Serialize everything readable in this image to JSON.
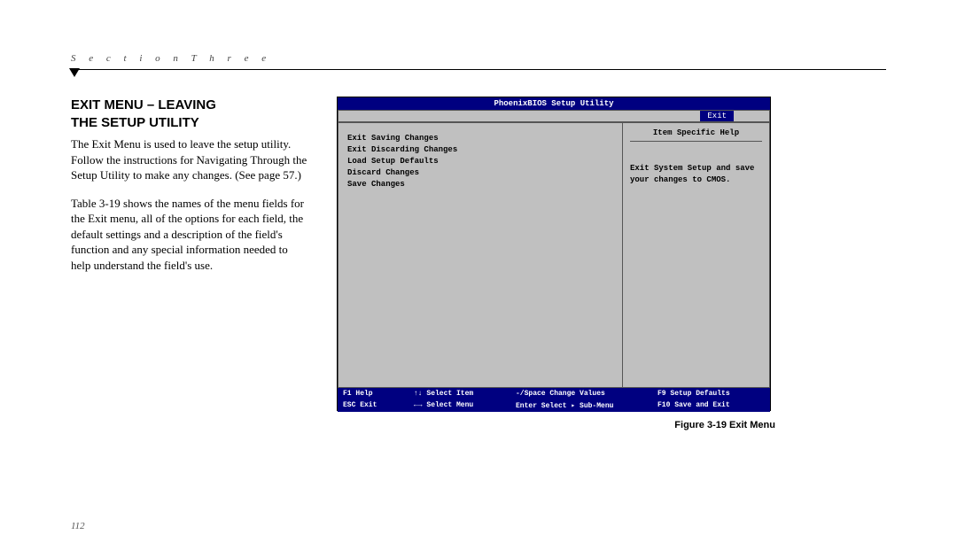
{
  "section_header": "S e c t i o n   T h r e e",
  "heading_line1": "EXIT MENU – LEAVING",
  "heading_line2": "THE SETUP UTILITY",
  "para1": "The Exit Menu is used to leave the setup utility. Follow the instructions for Navigating Through the Setup Utility to make any changes. (See page 57.)",
  "para2": "Table 3-19 shows the names of the menu fields for the Exit menu, all of the options for each field, the default settings and a description of the field's function and any special information needed to help understand the field's use.",
  "bios": {
    "title": "PhoenixBIOS Setup Utility",
    "tab": "Exit",
    "options": [
      "Exit Saving Changes",
      "Exit Discarding Changes",
      "Load Setup Defaults",
      "Discard Changes",
      "Save Changes"
    ],
    "help_title": "Item Specific Help",
    "help_body": "Exit System Setup and save your changes to CMOS.",
    "footer": {
      "r1c1": "F1  Help",
      "r1c2": "↑↓ Select Item",
      "r1c3": "-/Space Change Values",
      "r1c4": "F9 Setup Defaults",
      "r2c1": "ESC Exit",
      "r2c2": "←→ Select Menu",
      "r2c3": "Enter  Select ▸ Sub-Menu",
      "r2c4": "F10 Save and Exit"
    }
  },
  "caption": "Figure 3-19 Exit Menu",
  "page_number": "112"
}
